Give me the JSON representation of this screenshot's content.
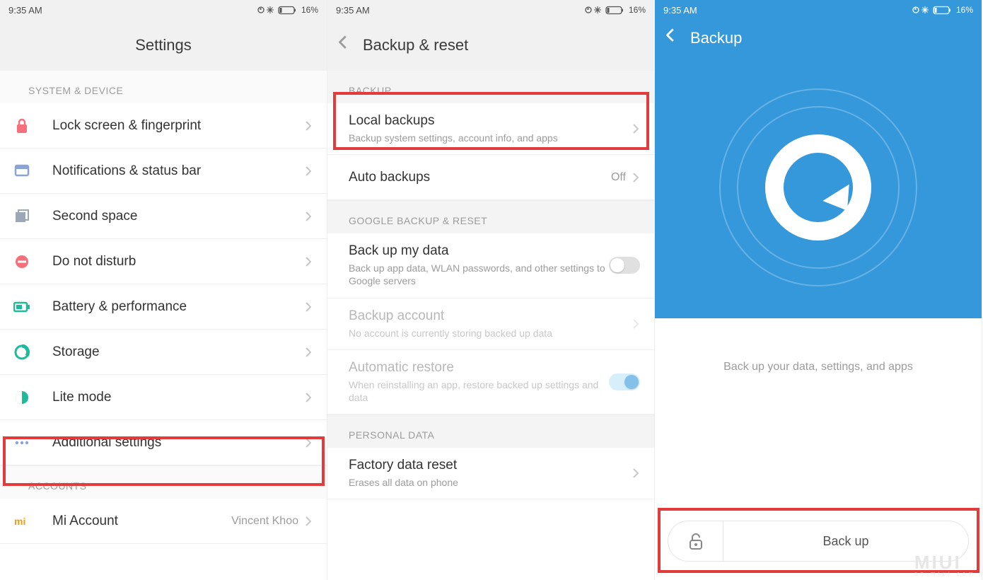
{
  "status": {
    "time": "9:35 AM",
    "battery": "16%"
  },
  "screen1": {
    "title": "Settings",
    "sectionSystem": "SYSTEM & DEVICE",
    "items": {
      "lock": "Lock screen & fingerprint",
      "notif": "Notifications & status bar",
      "secondspace": "Second space",
      "dnd": "Do not disturb",
      "battery": "Battery & performance",
      "storage": "Storage",
      "lite": "Lite mode",
      "additional": "Additional settings"
    },
    "sectionAccounts": "ACCOUNTS",
    "miAccount": {
      "label": "Mi Account",
      "value": "Vincent Khoo"
    }
  },
  "screen2": {
    "title": "Backup & reset",
    "sectionBackup": "BACKUP",
    "localBackups": {
      "title": "Local backups",
      "sub": "Backup system settings, account info, and apps"
    },
    "autoBackups": {
      "title": "Auto backups",
      "value": "Off"
    },
    "sectionGoogle": "GOOGLE BACKUP & RESET",
    "backupMyData": {
      "title": "Back up my data",
      "sub": "Back up app data, WLAN passwords, and other settings to Google servers"
    },
    "backupAccount": {
      "title": "Backup account",
      "sub": "No account is currently storing backed up data"
    },
    "autoRestore": {
      "title": "Automatic restore",
      "sub": "When reinstalling an app, restore backed up settings and data"
    },
    "sectionPersonal": "PERSONAL DATA",
    "factoryReset": {
      "title": "Factory data reset",
      "sub": "Erases all data on phone"
    }
  },
  "screen3": {
    "title": "Backup",
    "caption": "Back up your data, settings, and apps",
    "button": "Back up"
  },
  "watermark": "MIUI",
  "watermark_sub": "en.miui.com"
}
